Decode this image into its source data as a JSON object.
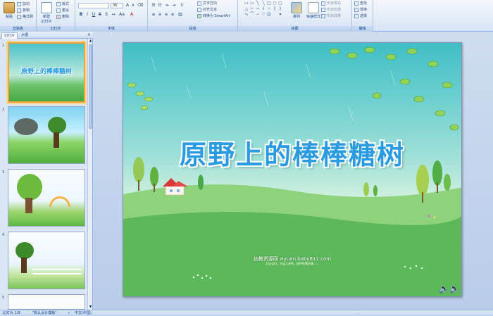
{
  "ribbon": {
    "groups": {
      "clipboard": "剪贴板",
      "slides": "幻灯片",
      "font": "字体",
      "paragraph": "段落",
      "drawing": "绘图",
      "editing": "编辑"
    },
    "clipboard": {
      "paste": "粘贴",
      "cut": "剪切",
      "copy": "复制",
      "format_painter": "格式刷"
    },
    "slides": {
      "new_slide": "新建\n幻灯片",
      "layout": "版式",
      "reset": "重设",
      "delete": "删除"
    },
    "font": {
      "size": "36"
    },
    "paragraph": {
      "text_direction": "文字方向",
      "align_text": "对齐文本",
      "smartart": "转换为 SmartArt"
    },
    "drawing": {
      "arrange": "排列",
      "quick_styles": "快速样式",
      "shape_fill": "形状填充",
      "shape_outline": "形状轮廓",
      "shape_effects": "形状效果"
    },
    "editing": {
      "find": "查找",
      "replace": "替换",
      "select": "选择"
    }
  },
  "left_panel": {
    "tabs": [
      "幻灯片",
      "大纲"
    ],
    "slide_numbers": [
      "1",
      "2",
      "3",
      "4",
      "5"
    ],
    "thumb1_title": "原野上的棒棒糖树"
  },
  "slide": {
    "title": "原野上的棒棒糖树",
    "watermark": "幼教资源网 ziyuan.baby611.com",
    "watermark_sub": "为宝宝们，为幼儿老师，提供免费资源……"
  },
  "statusbar": {
    "slide_count": "幻灯片 1/9",
    "theme": "\"默认设计模板\"",
    "language": "中文(中国)"
  },
  "colors": {
    "ribbon_text": "#15428b",
    "selected_thumb": "#f6a33c",
    "title_blue": "#2a9be0"
  }
}
